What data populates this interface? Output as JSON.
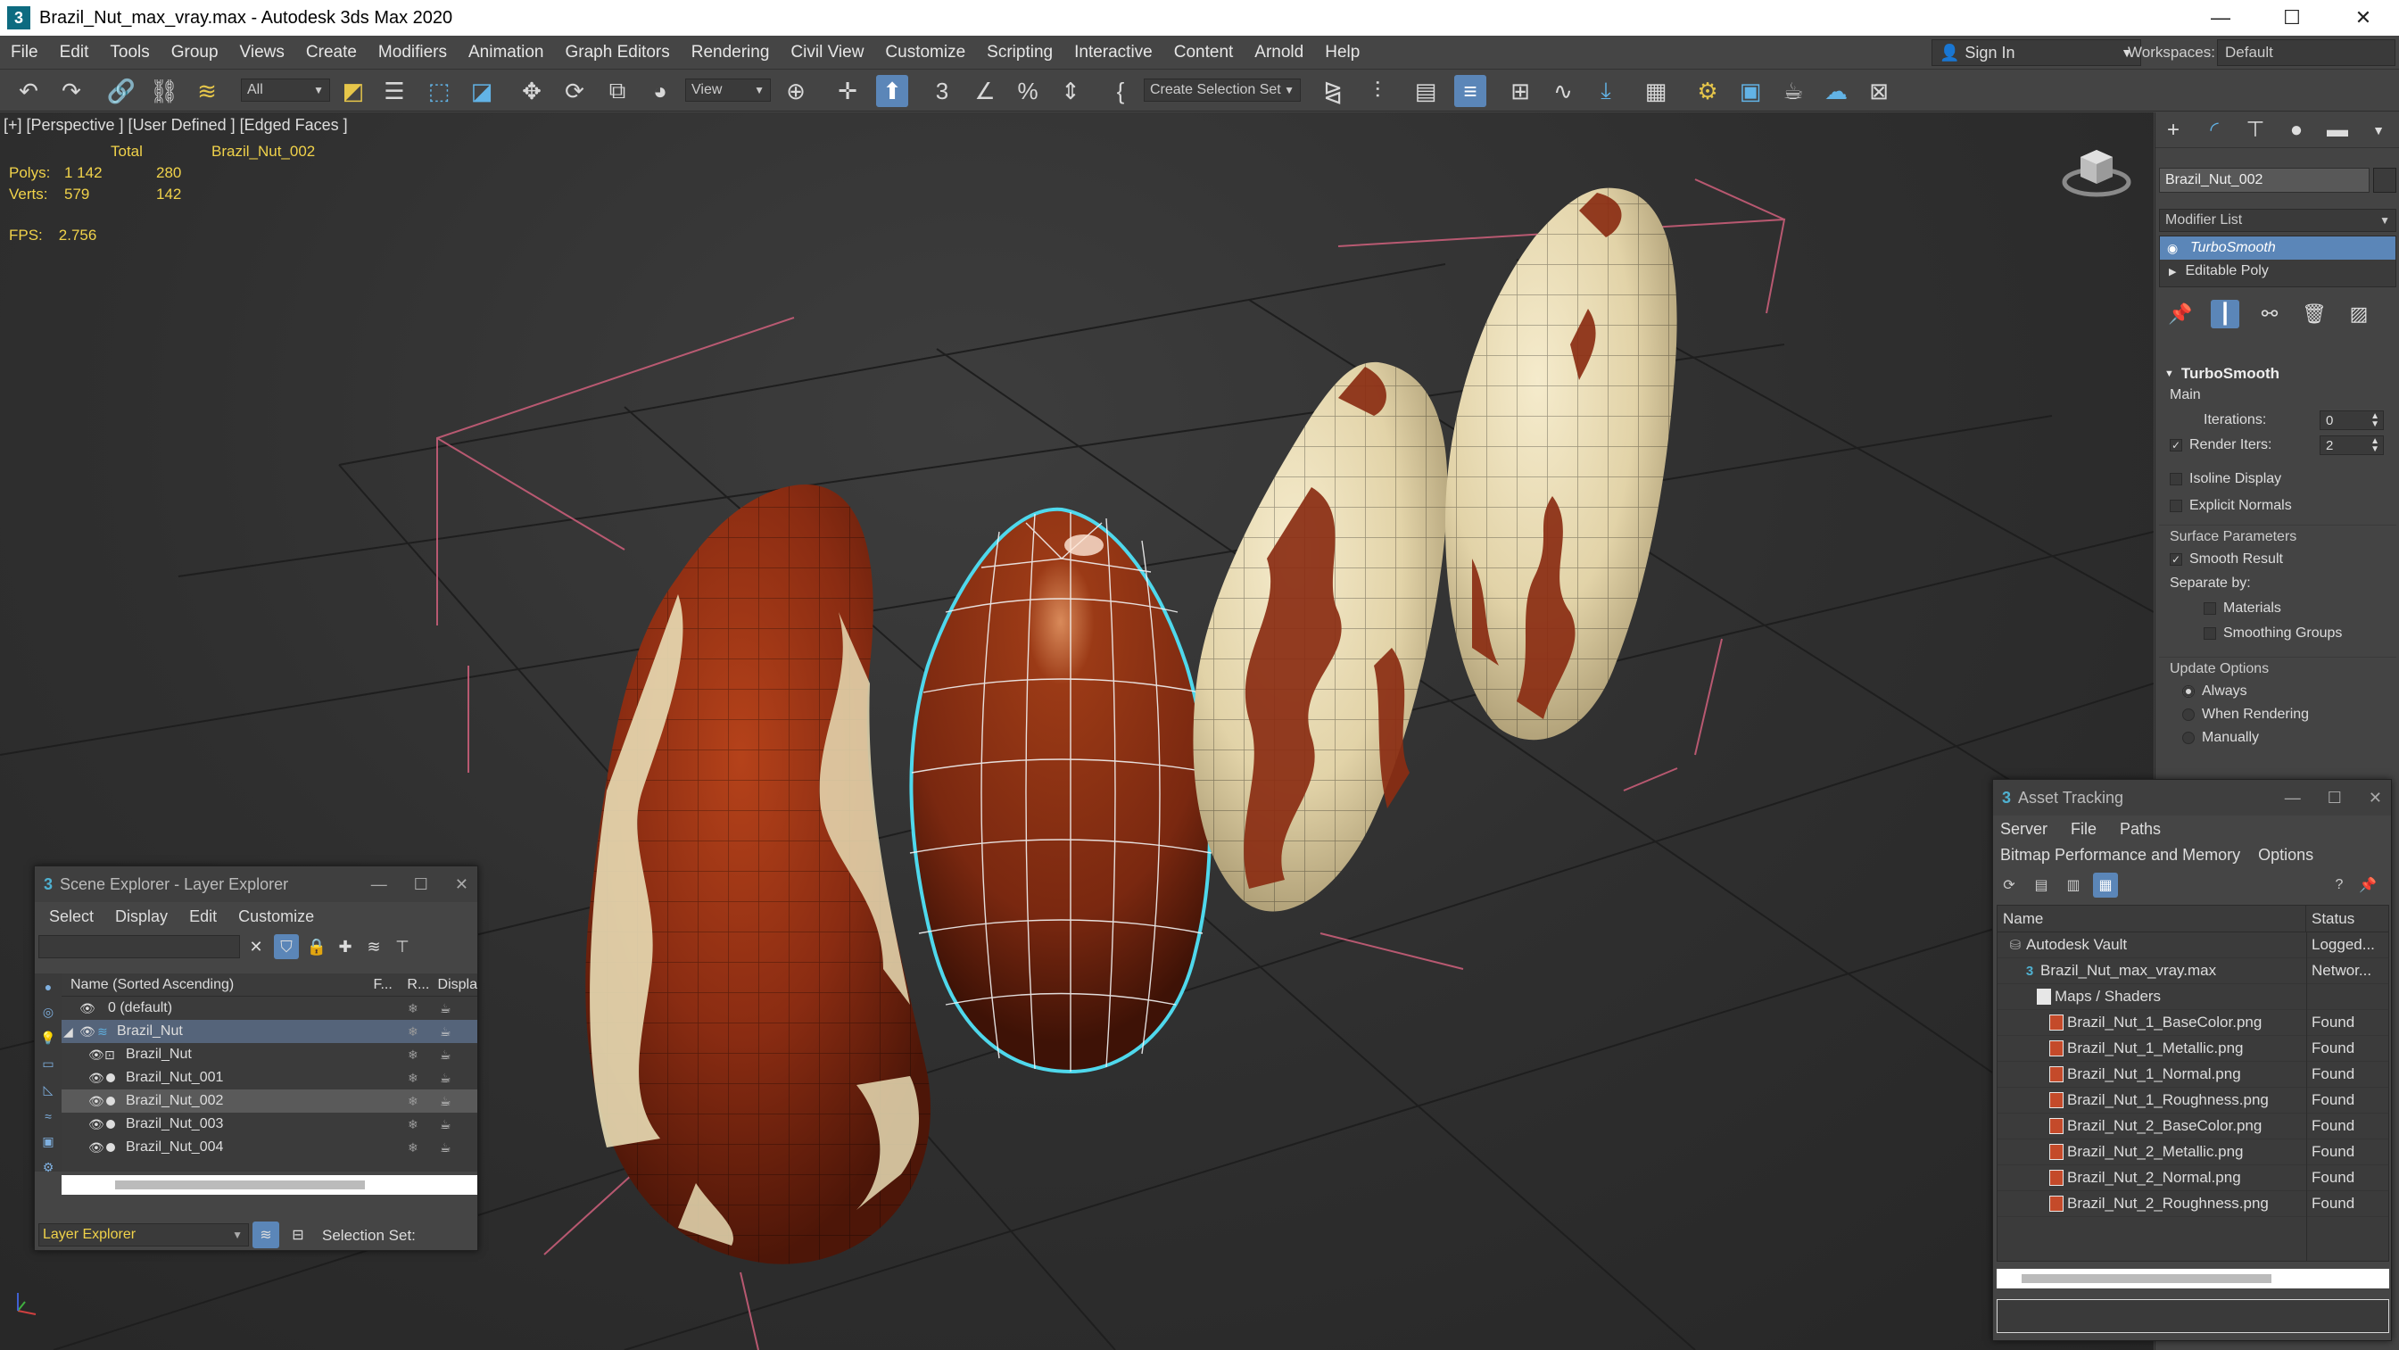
{
  "window": {
    "title": "Brazil_Nut_max_vray.max - Autodesk 3ds Max 2020",
    "app_icon_glyph": "3",
    "minimize_glyph": "—",
    "maximize_glyph": "☐",
    "close_glyph": "✕"
  },
  "menubar": {
    "items": [
      "File",
      "Edit",
      "Tools",
      "Group",
      "Views",
      "Create",
      "Modifiers",
      "Animation",
      "Graph Editors",
      "Rendering",
      "Civil View",
      "Customize",
      "Scripting",
      "Interactive",
      "Content",
      "Arnold",
      "Help"
    ],
    "sign_in": "Sign In",
    "workspaces_label": "Workspaces:",
    "workspace_value": "Default"
  },
  "toolbar": {
    "selection_filter": "All",
    "ref_coord": "View",
    "create_selection_set": "Create Selection Set",
    "icons": [
      "undo-icon",
      "redo-icon",
      "link-icon",
      "unlink-icon",
      "bind-space-warp-icon",
      "select-object-icon",
      "select-by-name-icon",
      "rect-selection-icon",
      "window-crossing-icon",
      "move-icon",
      "rotate-icon",
      "scale-icon",
      "place-icon",
      "pivot-icon",
      "manipulate-icon",
      "snap-3d-icon",
      "angle-snap-icon",
      "percent-snap-icon",
      "spinner-snap-icon",
      "named-selection-icon",
      "mirror-icon",
      "align-icon",
      "layer-explorer-icon",
      "toggle-ribbon-icon",
      "curve-editor-icon",
      "schematic-view-icon",
      "material-editor-icon",
      "render-setup-icon",
      "rendered-frame-icon",
      "render-icon",
      "render-online-icon",
      "render-environment-icon"
    ]
  },
  "viewport": {
    "label": "[+] [Perspective ] [User Defined ] [Edged Faces ]",
    "stats_header": [
      "",
      "Total",
      "Brazil_Nut_002"
    ],
    "stats": [
      {
        "label": "Polys:",
        "total": "1 142",
        "selected": "280"
      },
      {
        "label": "Verts:",
        "total": "579",
        "selected": "142"
      }
    ],
    "fps_label": "FPS:",
    "fps_value": "2.756"
  },
  "command_panel": {
    "tabs": [
      "create-tab-icon",
      "modify-tab-icon",
      "hierarchy-tab-icon",
      "motion-tab-icon",
      "display-tab-icon",
      "utilities-tab-icon"
    ],
    "object_name": "Brazil_Nut_002",
    "modifier_list": "Modifier List",
    "stack": [
      {
        "name": "TurboSmooth",
        "selected": true
      },
      {
        "name": "Editable Poly",
        "selected": false
      }
    ],
    "turbosmooth": {
      "title": "TurboSmooth",
      "main_label": "Main",
      "iterations_label": "Iterations:",
      "iterations_value": "0",
      "render_iters_label": "Render Iters:",
      "render_iters_value": "2",
      "isoline_display": "Isoline Display",
      "explicit_normals": "Explicit Normals",
      "surface_parameters": "Surface Parameters",
      "smooth_result": "Smooth Result",
      "separate_by": "Separate by:",
      "materials": "Materials",
      "smoothing_groups": "Smoothing Groups",
      "update_options": "Update Options",
      "always": "Always",
      "when_rendering": "When Rendering",
      "manually": "Manually"
    }
  },
  "scene_explorer": {
    "title": "Scene Explorer - Layer Explorer",
    "menu": [
      "Select",
      "Display",
      "Edit",
      "Customize"
    ],
    "col_name": "Name (Sorted Ascending)",
    "col_freeze": "F...",
    "col_render": "R...",
    "col_display": "Displa",
    "rows": [
      {
        "name": "0 (default)",
        "indent": 0,
        "type": "layer"
      },
      {
        "name": "Brazil_Nut",
        "indent": 0,
        "type": "layer-open"
      },
      {
        "name": "Brazil_Nut",
        "indent": 1,
        "type": "group"
      },
      {
        "name": "Brazil_Nut_001",
        "indent": 1,
        "type": "object"
      },
      {
        "name": "Brazil_Nut_002",
        "indent": 1,
        "type": "object"
      },
      {
        "name": "Brazil_Nut_003",
        "indent": 1,
        "type": "object"
      },
      {
        "name": "Brazil_Nut_004",
        "indent": 1,
        "type": "object"
      }
    ],
    "footer_layer": "Layer Explorer",
    "footer_selection_set": "Selection Set:"
  },
  "asset_tracking": {
    "title": "Asset Tracking",
    "menu1": [
      "Server",
      "File",
      "Paths"
    ],
    "menu2": [
      "Bitmap Performance and Memory",
      "Options"
    ],
    "col_name": "Name",
    "col_status": "Status",
    "rows": [
      {
        "name": "Autodesk Vault",
        "status": "Logged...",
        "indent": 0,
        "icon": "vault"
      },
      {
        "name": "Brazil_Nut_max_vray.max",
        "status": "Networ...",
        "indent": 1,
        "icon": "max"
      },
      {
        "name": "Maps / Shaders",
        "status": "",
        "indent": 2,
        "icon": "folder"
      },
      {
        "name": "Brazil_Nut_1_BaseColor.png",
        "status": "Found",
        "indent": 3,
        "icon": "png"
      },
      {
        "name": "Brazil_Nut_1_Metallic.png",
        "status": "Found",
        "indent": 3,
        "icon": "png"
      },
      {
        "name": "Brazil_Nut_1_Normal.png",
        "status": "Found",
        "indent": 3,
        "icon": "png"
      },
      {
        "name": "Brazil_Nut_1_Roughness.png",
        "status": "Found",
        "indent": 3,
        "icon": "png"
      },
      {
        "name": "Brazil_Nut_2_BaseColor.png",
        "status": "Found",
        "indent": 3,
        "icon": "png"
      },
      {
        "name": "Brazil_Nut_2_Metallic.png",
        "status": "Found",
        "indent": 3,
        "icon": "png"
      },
      {
        "name": "Brazil_Nut_2_Normal.png",
        "status": "Found",
        "indent": 3,
        "icon": "png"
      },
      {
        "name": "Brazil_Nut_2_Roughness.png",
        "status": "Found",
        "indent": 3,
        "icon": "png"
      }
    ]
  },
  "colors": {
    "selection_blue": "#5b86b8",
    "stats_yellow": "#f0d24a",
    "selected_wire": "#4fd8ec",
    "bbox_pink": "#d0607c",
    "nut_brown": "#8a2c12",
    "nut_cream": "#e8dcb4"
  }
}
